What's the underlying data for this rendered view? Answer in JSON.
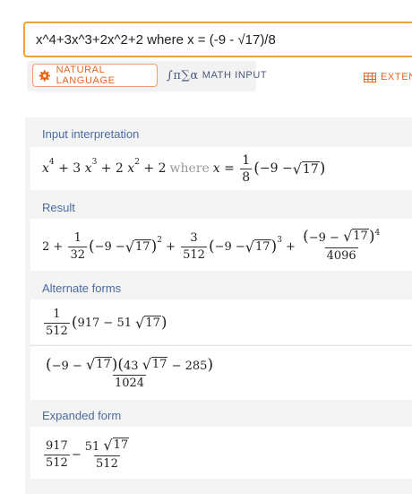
{
  "search": {
    "value": "x^4+3x^3+2x^2+2 where x = (-9 - √17)/8"
  },
  "modes": {
    "natural_language": "NATURAL LANGUAGE",
    "math_input": "MATH INPUT",
    "extended": "EXTEN",
    "math_icon": "∫π∑α"
  },
  "colors": {
    "accent": "#f2a23a",
    "orange": "#e8641a",
    "pod_title": "#4a6aa0"
  },
  "pods": {
    "input": {
      "title": "Input interpretation",
      "where_word": "where",
      "one": "1",
      "eight": "8",
      "seventeen": "17",
      "x": "x",
      "four": "4",
      "three_coef": "3",
      "three": "3",
      "two_coef": "2",
      "two_exp": "2",
      "plus2": "+ 2",
      "minus9": "−9 −"
    },
    "result": {
      "title": "Result",
      "two": "2 +",
      "one": "1",
      "d32": "32",
      "exp2": "2",
      "three": "3",
      "d512": "512",
      "exp3": "3",
      "exp4": "4",
      "d4096": "4096",
      "seventeen": "17",
      "minus9": "−9 −"
    },
    "alternate": {
      "title": "Alternate forms",
      "one": "1",
      "d512": "512",
      "expr1": "917 − 51",
      "seventeen": "17",
      "minus9": "−9 −",
      "f43": "43",
      "m285": "− 285",
      "d1024": "1024"
    },
    "expanded": {
      "title": "Expanded form",
      "n917": "917",
      "d512a": "512",
      "minus": "−",
      "n51": "51",
      "seventeen": "17",
      "d512b": "512"
    }
  }
}
